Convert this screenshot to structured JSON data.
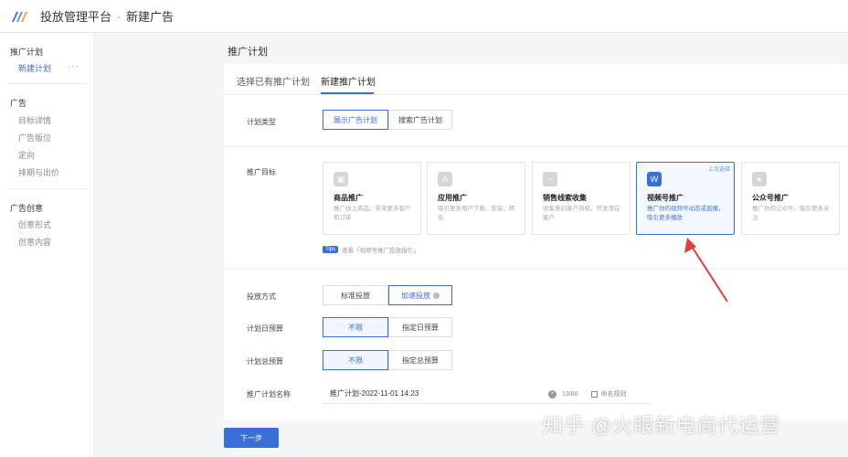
{
  "header": {
    "app_title": "投放管理平台",
    "separator": "-",
    "current_page": "新建广告"
  },
  "sidebar": {
    "groups": [
      {
        "label": "推广计划",
        "items": [
          "新建计划"
        ]
      },
      {
        "label": "广告",
        "items": [
          "目标详情",
          "广告版位",
          "定向",
          "排期与出价"
        ]
      },
      {
        "label": "广告创意",
        "items": [
          "创意形式",
          "创意内容"
        ]
      }
    ],
    "more": "···"
  },
  "main": {
    "title": "推广计划",
    "tabs": [
      {
        "label": "选择已有推广计划"
      },
      {
        "label": "新建推广计划"
      }
    ]
  },
  "form": {
    "plan_type": {
      "label": "计划类型",
      "options": [
        "展示广告计划",
        "搜索广告计划"
      ]
    },
    "goal": {
      "label": "推广目标",
      "cards": [
        {
          "title": "商品推广",
          "desc": "推广线上商品，带来更多客户和订单"
        },
        {
          "title": "应用推广",
          "desc": "吸引更多用户下载、安装、转化"
        },
        {
          "title": "销售线索收集",
          "desc": "收集意向客户商机，开发潜在客户"
        },
        {
          "title": "视频号推广",
          "desc": "推广你的视频号动态或直播，吸引更多播放",
          "tag": "上次选择"
        },
        {
          "title": "公众号推广",
          "desc": "推广你的公众号，吸引更多关注"
        }
      ],
      "tips_badge": "Tips",
      "tips_text": "查看「视频号推广投放指引」"
    },
    "delivery": {
      "label": "投放方式",
      "options": [
        "标准投放",
        "加速投放"
      ]
    },
    "daily_budget": {
      "label": "计划日预算",
      "options": [
        "不限",
        "指定日预算"
      ]
    },
    "total_budget": {
      "label": "计划总预算",
      "options": [
        "不限",
        "指定总预算"
      ]
    },
    "plan_name": {
      "label": "推广计划名称",
      "value": "推广计划-2022-11-01 14:23",
      "counter": "13/60",
      "rule": "命名规则"
    }
  },
  "actions": {
    "next": "下一步"
  },
  "watermark": "知乎 @火眼新电商代运营",
  "colors": {
    "accent": "#3b6fd8",
    "arrow": "#e0413c"
  }
}
